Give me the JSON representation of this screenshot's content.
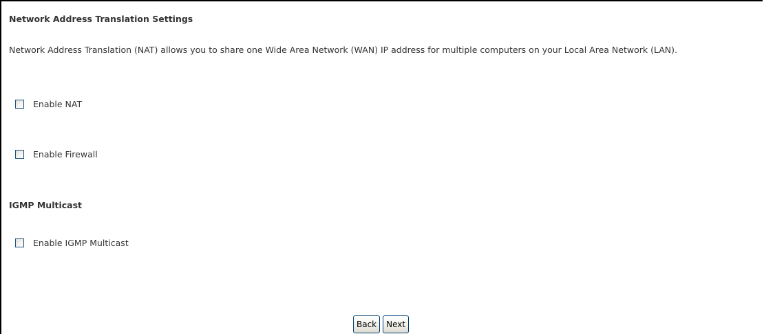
{
  "nat_section": {
    "title": "Network Address Translation Settings",
    "description": "Network Address Translation (NAT) allows you to share one Wide Area Network (WAN) IP address for multiple computers on your Local Area Network (LAN).",
    "enable_nat": {
      "label": "Enable NAT",
      "checked": false
    },
    "enable_firewall": {
      "label": "Enable Firewall",
      "checked": false
    }
  },
  "igmp_section": {
    "title": "IGMP Multicast",
    "enable_igmp": {
      "label": "Enable IGMP Multicast",
      "checked": false
    }
  },
  "buttons": {
    "back_label": "Back",
    "next_label": "Next"
  }
}
